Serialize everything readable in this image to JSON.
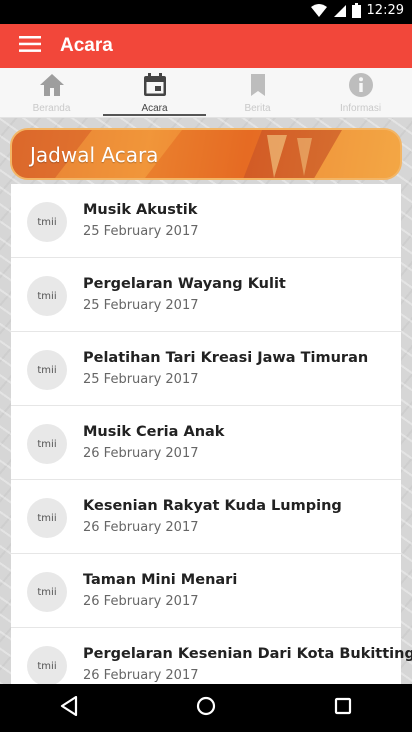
{
  "status_bar": {
    "time": "12:29"
  },
  "app_bar": {
    "title": "Acara"
  },
  "tabs": [
    {
      "label": "Beranda",
      "icon": "home-icon",
      "active": false
    },
    {
      "label": "Acara",
      "icon": "calendar-icon",
      "active": true
    },
    {
      "label": "Berita",
      "icon": "bookmark-icon",
      "active": false
    },
    {
      "label": "Informasi",
      "icon": "info-icon",
      "active": false
    }
  ],
  "banner": {
    "title": "Jadwal Acara"
  },
  "events": [
    {
      "logo": "tmii",
      "name": "Musik Akustik",
      "date": "25 February 2017"
    },
    {
      "logo": "tmii",
      "name": "Pergelaran Wayang Kulit",
      "date": "25 February 2017"
    },
    {
      "logo": "tmii",
      "name": "Pelatihan Tari Kreasi Jawa Timuran",
      "date": "25 February 2017"
    },
    {
      "logo": "tmii",
      "name": "Musik Ceria Anak",
      "date": "26 February 2017"
    },
    {
      "logo": "tmii",
      "name": "Kesenian Rakyat Kuda Lumping",
      "date": "26 February 2017"
    },
    {
      "logo": "tmii",
      "name": "Taman Mini Menari",
      "date": "26 February 2017"
    },
    {
      "logo": "tmii",
      "name": "Pergelaran Kesenian Dari Kota Bukittinggi",
      "date": "26 February 2017"
    }
  ],
  "colors": {
    "accent": "#f2473a",
    "banner": "#e8782c",
    "active_tab_indicator": "#555555"
  }
}
